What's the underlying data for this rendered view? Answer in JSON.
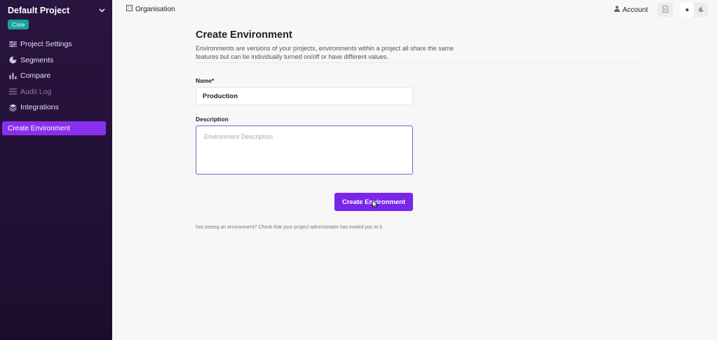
{
  "sidebar": {
    "project_title": "Default Project",
    "badge": "Core",
    "items": [
      {
        "label": "Project Settings",
        "icon": "sliders-icon"
      },
      {
        "label": "Segments",
        "icon": "pie-chart-icon"
      },
      {
        "label": "Compare",
        "icon": "bar-chart-icon"
      },
      {
        "label": "Audit Log",
        "icon": "list-icon"
      },
      {
        "label": "Integrations",
        "icon": "layers-icon"
      }
    ],
    "active_item": "Create Environment"
  },
  "topbar": {
    "org_label": "Organisation",
    "account_label": "Account"
  },
  "main": {
    "title": "Create Environment",
    "description": "Environments are versions of your projects, environments within a project all share the same features but can be individually turned on/off or have different values.",
    "name_label": "Name*",
    "name_value": "Production",
    "description_label": "Description",
    "description_placeholder": "Environment Description",
    "submit_label": "Create Environment",
    "hint": "Not seeing an environment? Check that your project administrator has invited you to it."
  },
  "colors": {
    "accent": "#7a25ea",
    "sidebar_bg": "#2a1440",
    "badge": "#1aa39a"
  }
}
